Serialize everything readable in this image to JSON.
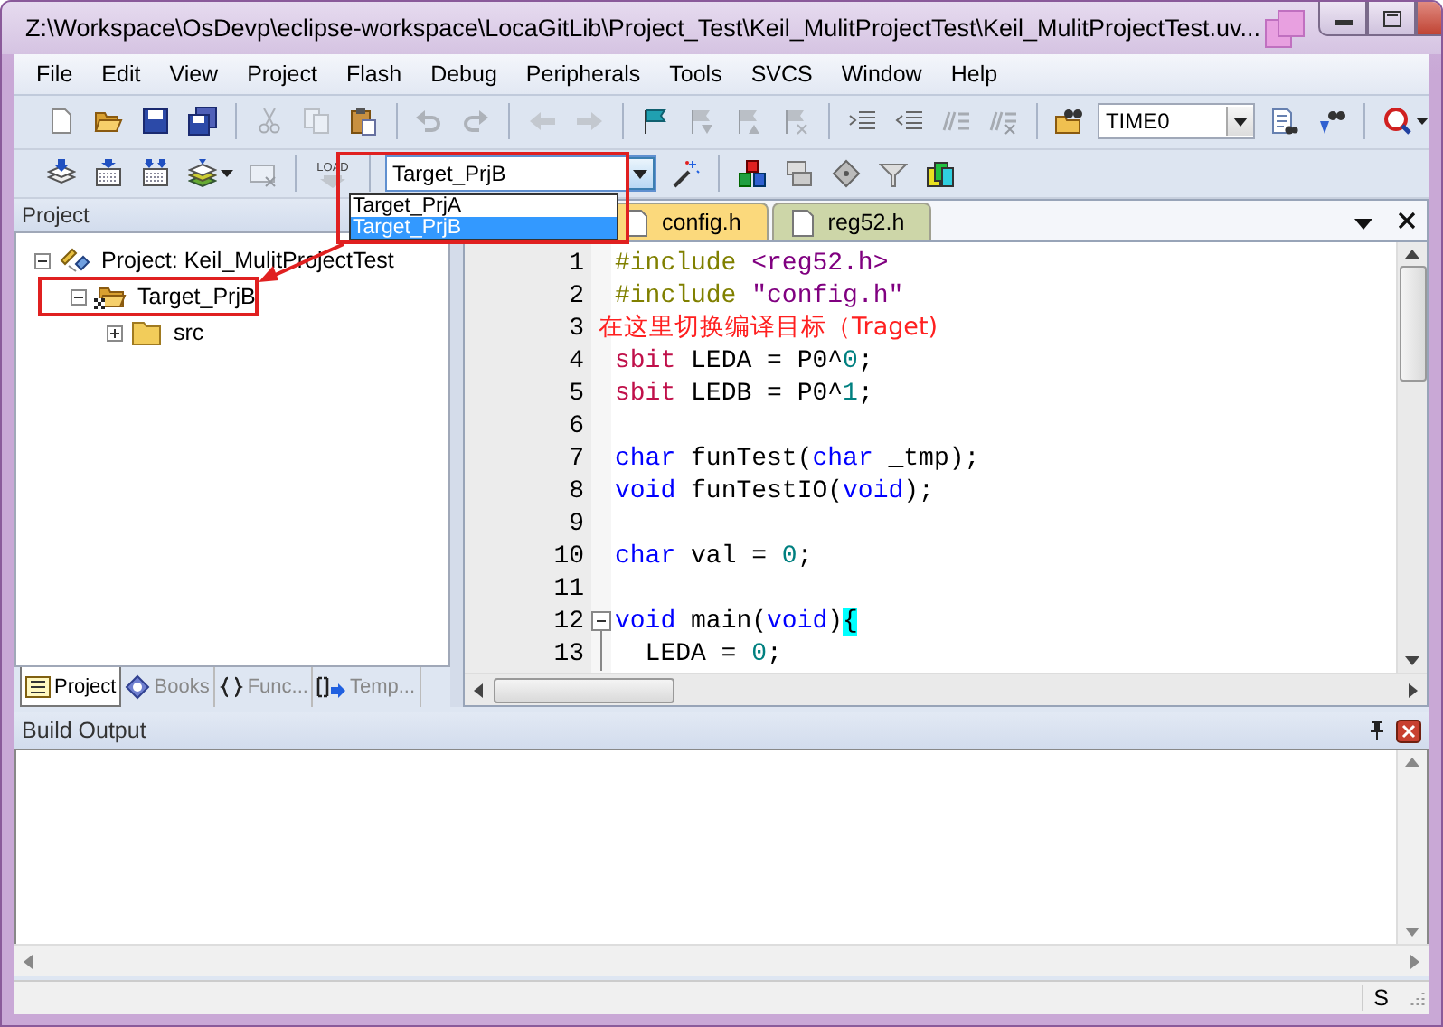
{
  "window": {
    "title": "Z:\\Workspace\\OsDevp\\eclipse-workspace\\LocaGitLib\\Project_Test\\Keil_MulitProjectTest\\Keil_MulitProjectTest.uv..."
  },
  "menu": [
    "File",
    "Edit",
    "View",
    "Project",
    "Flash",
    "Debug",
    "Peripherals",
    "Tools",
    "SVCS",
    "Window",
    "Help"
  ],
  "toolbar_1": [
    [
      {
        "kind": "new-file",
        "disabled": false
      },
      {
        "kind": "open-folder",
        "disabled": false
      },
      {
        "kind": "save",
        "disabled": false
      },
      {
        "kind": "save-all",
        "disabled": false
      }
    ],
    [
      {
        "kind": "cut",
        "disabled": true
      },
      {
        "kind": "copy",
        "disabled": true
      },
      {
        "kind": "paste",
        "disabled": false
      }
    ],
    [
      {
        "kind": "undo",
        "disabled": true
      },
      {
        "kind": "redo",
        "disabled": true
      }
    ],
    [
      {
        "kind": "back",
        "disabled": true
      },
      {
        "kind": "forward",
        "disabled": true
      }
    ],
    [
      {
        "kind": "flag",
        "disabled": false
      },
      {
        "kind": "flag-prev",
        "disabled": true
      },
      {
        "kind": "flag-next",
        "disabled": true
      },
      {
        "kind": "flag-clear",
        "disabled": true
      }
    ],
    [
      {
        "kind": "indent",
        "disabled": false
      },
      {
        "kind": "outdent",
        "disabled": false
      },
      {
        "kind": "comment",
        "disabled": true
      },
      {
        "kind": "uncomment",
        "disabled": true
      }
    ],
    [
      {
        "kind": "find-folder",
        "disabled": false
      },
      {
        "kind": "combo",
        "value": "TIME0"
      },
      {
        "kind": "find-doc",
        "disabled": false
      },
      {
        "kind": "binoculars",
        "disabled": false
      }
    ],
    [
      {
        "kind": "debug",
        "disabled": false
      }
    ]
  ],
  "toolbar_2": [
    [
      {
        "kind": "build-stack",
        "disabled": false
      },
      {
        "kind": "grid",
        "disabled": false
      },
      {
        "kind": "grid-2",
        "disabled": false
      },
      {
        "kind": "layers",
        "disabled": false
      },
      {
        "kind": "grid-x",
        "disabled": true
      }
    ],
    [
      {
        "kind": "load",
        "label": "LOAD",
        "disabled": true
      }
    ],
    [
      {
        "kind": "combo",
        "value": "Target_PrjB"
      },
      {
        "kind": "wand",
        "disabled": false
      }
    ],
    [
      {
        "kind": "blocks",
        "disabled": false
      },
      {
        "kind": "windows",
        "disabled": false
      },
      {
        "kind": "diamond",
        "disabled": false
      },
      {
        "kind": "funnel",
        "disabled": false
      },
      {
        "kind": "palette",
        "disabled": false
      }
    ]
  ],
  "target_dropdown": {
    "options": [
      {
        "label": "Target_PrjA",
        "selected": false
      },
      {
        "label": "Target_PrjB",
        "selected": true
      }
    ]
  },
  "project_panel": {
    "title": "Project",
    "tree": [
      {
        "kind": "project",
        "label": "Project: Keil_MulitProjectTest",
        "expanded": true,
        "children": [
          {
            "kind": "target",
            "label": "Target_PrjB",
            "expanded": true,
            "children": [
              {
                "kind": "group",
                "label": "src",
                "expanded": false
              }
            ]
          }
        ]
      }
    ],
    "tabs": [
      {
        "label": "Project",
        "selected": true
      },
      {
        "label": "Books",
        "selected": false
      },
      {
        "label": "Func...",
        "selected": false
      },
      {
        "label": "Temp...",
        "selected": false
      }
    ]
  },
  "annotation": {
    "text": "在这里切换编译目标（Traget)"
  },
  "editor": {
    "tabs": [
      {
        "label": "config.h",
        "selected": true
      },
      {
        "label": "reg52.h",
        "selected": false
      }
    ],
    "lines": [
      {
        "number": "1",
        "kind": "plain",
        "tokens": [
          {
            "kind": "directive",
            "text": "#include"
          },
          {
            "kind": "string",
            "text": " <reg52.h>"
          }
        ]
      },
      {
        "number": "2",
        "kind": "plain",
        "tokens": [
          {
            "kind": "directive",
            "text": "#include"
          },
          {
            "kind": "string",
            "text": " \"config.h\""
          }
        ]
      },
      {
        "number": "3",
        "kind": "plain"
      },
      {
        "number": "4",
        "kind": "plain",
        "tokens": [
          {
            "kind": "sfr",
            "text": "sbit"
          },
          {
            "kind": "plain",
            "text": " LEDA = P0^"
          },
          {
            "kind": "number",
            "text": "0"
          },
          {
            "kind": "plain",
            "text": ";"
          }
        ]
      },
      {
        "number": "5",
        "kind": "plain",
        "tokens": [
          {
            "kind": "sfr",
            "text": "sbit"
          },
          {
            "kind": "plain",
            "text": " LEDB = P0^"
          },
          {
            "kind": "number",
            "text": "1"
          },
          {
            "kind": "plain",
            "text": ";"
          }
        ]
      },
      {
        "number": "6",
        "kind": "plain"
      },
      {
        "number": "7",
        "kind": "plain",
        "tokens": [
          {
            "kind": "keyword",
            "text": "char"
          },
          {
            "kind": "plain",
            "text": " funTest("
          },
          {
            "kind": "keyword",
            "text": "char"
          },
          {
            "kind": "plain",
            "text": " _tmp);"
          }
        ]
      },
      {
        "number": "8",
        "kind": "plain",
        "tokens": [
          {
            "kind": "keyword",
            "text": "void"
          },
          {
            "kind": "plain",
            "text": " funTestIO("
          },
          {
            "kind": "keyword",
            "text": "void"
          },
          {
            "kind": "plain",
            "text": ");"
          }
        ]
      },
      {
        "number": "9",
        "kind": "plain"
      },
      {
        "number": "10",
        "kind": "plain",
        "tokens": [
          {
            "kind": "keyword",
            "text": "char"
          },
          {
            "kind": "plain",
            "text": " val = "
          },
          {
            "kind": "number",
            "text": "0"
          },
          {
            "kind": "plain",
            "text": ";"
          }
        ]
      },
      {
        "number": "11",
        "kind": "plain"
      },
      {
        "number": "12",
        "kind": "fold-start",
        "tokens": [
          {
            "kind": "keyword",
            "text": "void"
          },
          {
            "kind": "plain",
            "text": " main("
          },
          {
            "kind": "keyword",
            "text": "void"
          },
          {
            "kind": "plain",
            "text": ")"
          },
          {
            "kind": "brace",
            "text": "{"
          }
        ]
      },
      {
        "number": "13",
        "kind": "fold-body",
        "tokens": [
          {
            "kind": "plain",
            "text": "  LEDA = "
          },
          {
            "kind": "number",
            "text": "0"
          },
          {
            "kind": "plain",
            "text": ";"
          }
        ]
      }
    ]
  },
  "build_output": {
    "title": "Build Output"
  },
  "status_bar": {
    "text": "S"
  }
}
